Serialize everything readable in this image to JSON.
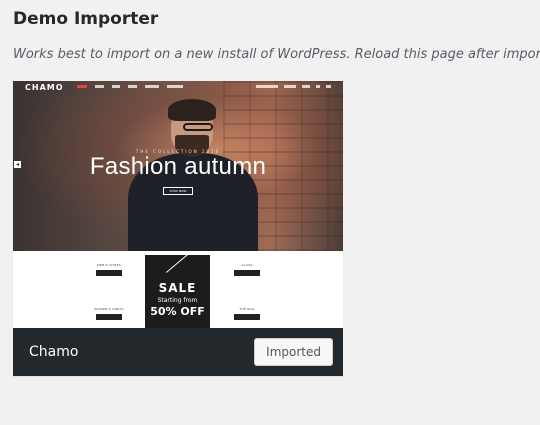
{
  "page": {
    "title": "Demo Importer",
    "description": "Works best to import on a new install of WordPress. Reload this page after imported"
  },
  "demo": {
    "name": "Chamo",
    "button_label": "Imported",
    "preview": {
      "logo": "CHAMO",
      "hero_subtitle": "THE COLLECTION 2018",
      "hero_title": "Fashion autumn",
      "hero_button": "SHOP NOW",
      "categories": [
        {
          "label": "MEN'S SHOES",
          "button": "SHOP NOW"
        },
        {
          "label": "GLASS",
          "button": "SHOP NOW"
        },
        {
          "label": "WOMEN'S DRESS",
          "button": "SHOP NOW"
        },
        {
          "label": "THE BAG",
          "button": "SHOP NOW"
        }
      ],
      "sale": {
        "title": "SALE",
        "subtitle": "Starting from",
        "discount": "50% OFF"
      }
    }
  },
  "colors": {
    "page_bg": "#f1f1f1",
    "footer_bg": "#23282d",
    "nav_active": "#e6423b"
  }
}
